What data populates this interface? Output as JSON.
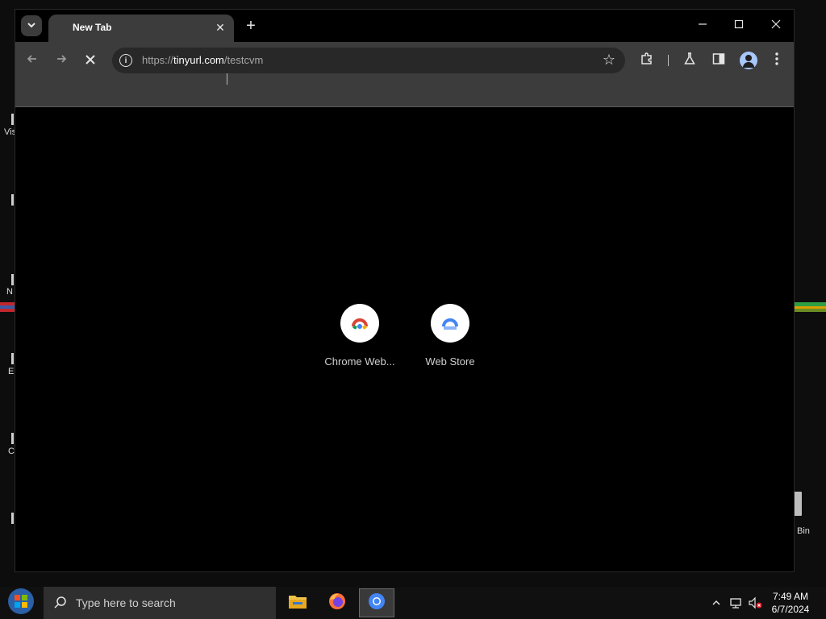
{
  "desktop": {
    "fragments": [
      "Vis",
      "N",
      "E",
      "C"
    ],
    "bin_label": "Bin"
  },
  "browser": {
    "tab": {
      "title": "New Tab"
    },
    "address_bar": {
      "scheme": "https://",
      "host": "tinyurl.com",
      "path": "/testcvm"
    },
    "shortcuts": [
      {
        "label": "Chrome Web...",
        "icon": "chrome-web-store-icon"
      },
      {
        "label": "Web Store",
        "icon": "web-store-icon"
      }
    ]
  },
  "taskbar": {
    "search_placeholder": "Type here to search",
    "clock": {
      "time": "7:49 AM",
      "date": "6/7/2024"
    }
  },
  "colors": {
    "browser_chrome": "#3c3c3c",
    "omnibox": "#282828",
    "avatar": "#a8c7fa"
  }
}
